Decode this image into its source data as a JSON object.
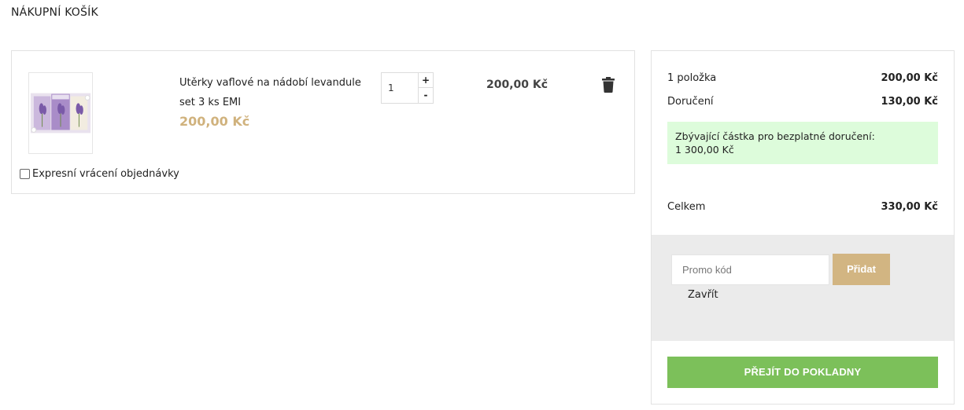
{
  "page": {
    "title": "NÁKUPNÍ KOŠÍK"
  },
  "cart": {
    "item": {
      "name": "Utěrky vaflové na nádobí levandule set 3 ks EMI",
      "unit_price": "200,00 Kč",
      "quantity": "1",
      "line_total": "200,00 Kč",
      "image_icon": "product-thumbnail"
    },
    "qty_plus": "+",
    "qty_minus": "-",
    "express_return": {
      "label": "Expresní vrácení objednávky",
      "checked": false
    }
  },
  "summary": {
    "items_label": "1 položka",
    "items_value": "200,00 Kč",
    "shipping_label": "Doručení",
    "shipping_value": "130,00 Kč",
    "free_shipping_text": "Zbývající částka pro bezplatné doručení:",
    "free_shipping_amount": "1 300,00 Kč",
    "total_label": "Celkem",
    "total_value": "330,00 Kč",
    "promo": {
      "placeholder": "Promo kód",
      "add_label": "Přidat",
      "close_label": "Zavřít"
    },
    "checkout_label": "PŘEJÍT DO POKLADNY"
  },
  "colors": {
    "price_accent": "#d0b27d",
    "promo_button": "#d2b582",
    "checkout_button": "#7cc05a",
    "free_shipping_bg": "#ddfcdb",
    "promo_area_bg": "#ebebeb"
  }
}
